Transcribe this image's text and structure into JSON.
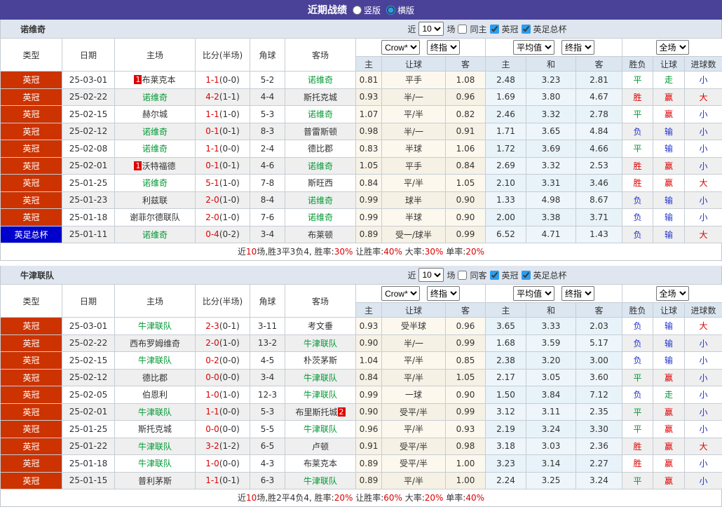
{
  "colors": {
    "titlebar_purple": "#4a4298",
    "league_badge_red": "#cc3300",
    "cup_badge_blue": "#0000cc",
    "win_red": "#dd0000",
    "draw_green": "#009933",
    "lose_blue": "#2233cc",
    "header_blue": "#dce6f0",
    "odds_cream": "#fdf8ee",
    "odds_lightblue": "#e7f2f9"
  },
  "titlebar": {
    "title": "近期战绩",
    "radios": [
      {
        "label": "竖版",
        "checked": false
      },
      {
        "label": "横版",
        "checked": true
      }
    ]
  },
  "table_header": {
    "type": "类型",
    "date": "日期",
    "home": "主场",
    "score": "比分(半场)",
    "corner": "角球",
    "away": "客场",
    "group1_select1": "Crow*",
    "group1_select2": "终指",
    "group2_select1": "平均值",
    "group2_select2": "终指",
    "group3_select": "全场",
    "sub1_home": "主",
    "sub1_line": "让球",
    "sub1_away": "客",
    "sub2_home": "主",
    "sub2_draw": "和",
    "sub2_away": "客",
    "sub3_wl": "胜负",
    "sub3_handicap": "让球",
    "sub3_goals": "进球数"
  },
  "sections": [
    {
      "team": "诺维奇",
      "filter": {
        "near_label": "近",
        "count": "10",
        "games_label": "场",
        "same_label": "同主",
        "same_checked": false,
        "leagues": [
          {
            "label": "英冠",
            "checked": true
          },
          {
            "label": "英足总杯",
            "checked": true
          }
        ]
      },
      "rows": [
        {
          "type": "英冠",
          "type_c": "t-red",
          "date": "25-03-01",
          "home_badge": "1",
          "home": "布莱克本",
          "home_c": "",
          "ft": "1-1",
          "ht": "(0-0)",
          "corner": "5-2",
          "away": "诺维奇",
          "away_badge": "",
          "away_c": "green",
          "o1h": "0.81",
          "o1l": "平手",
          "o1a": "1.08",
          "o2h": "2.48",
          "o2d": "3.23",
          "o2a": "2.81",
          "rw": "平",
          "rw_c": "green",
          "rh": "走",
          "rh_c": "green",
          "rg": "小",
          "rg_c": "blue"
        },
        {
          "type": "英冠",
          "type_c": "t-red",
          "date": "25-02-22",
          "home_badge": "",
          "home": "诺维奇",
          "home_c": "green",
          "ft": "4-2",
          "ht": "(1-1)",
          "corner": "4-4",
          "away": "斯托克城",
          "away_badge": "",
          "away_c": "",
          "o1h": "0.93",
          "o1l": "半/一",
          "o1a": "0.96",
          "o2h": "1.69",
          "o2d": "3.80",
          "o2a": "4.67",
          "rw": "胜",
          "rw_c": "red",
          "rh": "赢",
          "rh_c": "red",
          "rg": "大",
          "rg_c": "red"
        },
        {
          "type": "英冠",
          "type_c": "t-red",
          "date": "25-02-15",
          "home_badge": "",
          "home": "赫尔城",
          "home_c": "",
          "ft": "1-1",
          "ht": "(1-0)",
          "corner": "5-3",
          "away": "诺维奇",
          "away_badge": "",
          "away_c": "green",
          "o1h": "1.07",
          "o1l": "平/半",
          "o1a": "0.82",
          "o2h": "2.46",
          "o2d": "3.32",
          "o2a": "2.78",
          "rw": "平",
          "rw_c": "green",
          "rh": "赢",
          "rh_c": "red",
          "rg": "小",
          "rg_c": "blue"
        },
        {
          "type": "英冠",
          "type_c": "t-red",
          "date": "25-02-12",
          "home_badge": "",
          "home": "诺维奇",
          "home_c": "green",
          "ft": "0-1",
          "ht": "(0-1)",
          "corner": "8-3",
          "away": "普雷斯顿",
          "away_badge": "",
          "away_c": "",
          "o1h": "0.98",
          "o1l": "半/一",
          "o1a": "0.91",
          "o2h": "1.71",
          "o2d": "3.65",
          "o2a": "4.84",
          "rw": "负",
          "rw_c": "blue",
          "rh": "输",
          "rh_c": "blue",
          "rg": "小",
          "rg_c": "blue"
        },
        {
          "type": "英冠",
          "type_c": "t-red",
          "date": "25-02-08",
          "home_badge": "",
          "home": "诺维奇",
          "home_c": "green",
          "ft": "1-1",
          "ht": "(0-0)",
          "corner": "2-4",
          "away": "德比郡",
          "away_badge": "",
          "away_c": "",
          "o1h": "0.83",
          "o1l": "半球",
          "o1a": "1.06",
          "o2h": "1.72",
          "o2d": "3.69",
          "o2a": "4.66",
          "rw": "平",
          "rw_c": "green",
          "rh": "输",
          "rh_c": "blue",
          "rg": "小",
          "rg_c": "blue"
        },
        {
          "type": "英冠",
          "type_c": "t-red",
          "date": "25-02-01",
          "home_badge": "1",
          "home": "沃特福德",
          "home_c": "",
          "ft": "0-1",
          "ht": "(0-1)",
          "corner": "4-6",
          "away": "诺维奇",
          "away_badge": "",
          "away_c": "green",
          "o1h": "1.05",
          "o1l": "平手",
          "o1a": "0.84",
          "o2h": "2.69",
          "o2d": "3.32",
          "o2a": "2.53",
          "rw": "胜",
          "rw_c": "red",
          "rh": "赢",
          "rh_c": "red",
          "rg": "小",
          "rg_c": "blue"
        },
        {
          "type": "英冠",
          "type_c": "t-red",
          "date": "25-01-25",
          "home_badge": "",
          "home": "诺维奇",
          "home_c": "green",
          "ft": "5-1",
          "ht": "(1-0)",
          "corner": "7-8",
          "away": "斯旺西",
          "away_badge": "",
          "away_c": "",
          "o1h": "0.84",
          "o1l": "平/半",
          "o1a": "1.05",
          "o2h": "2.10",
          "o2d": "3.31",
          "o2a": "3.46",
          "rw": "胜",
          "rw_c": "red",
          "rh": "赢",
          "rh_c": "red",
          "rg": "大",
          "rg_c": "red"
        },
        {
          "type": "英冠",
          "type_c": "t-red",
          "date": "25-01-23",
          "home_badge": "",
          "home": "利兹联",
          "home_c": "",
          "ft": "2-0",
          "ht": "(1-0)",
          "corner": "8-4",
          "away": "诺维奇",
          "away_badge": "",
          "away_c": "green",
          "o1h": "0.99",
          "o1l": "球半",
          "o1a": "0.90",
          "o2h": "1.33",
          "o2d": "4.98",
          "o2a": "8.67",
          "rw": "负",
          "rw_c": "blue",
          "rh": "输",
          "rh_c": "blue",
          "rg": "小",
          "rg_c": "blue"
        },
        {
          "type": "英冠",
          "type_c": "t-red",
          "date": "25-01-18",
          "home_badge": "",
          "home": "谢菲尔德联队",
          "home_c": "",
          "ft": "2-0",
          "ht": "(1-0)",
          "corner": "7-6",
          "away": "诺维奇",
          "away_badge": "",
          "away_c": "green",
          "o1h": "0.99",
          "o1l": "半球",
          "o1a": "0.90",
          "o2h": "2.00",
          "o2d": "3.38",
          "o2a": "3.71",
          "rw": "负",
          "rw_c": "blue",
          "rh": "输",
          "rh_c": "blue",
          "rg": "小",
          "rg_c": "blue"
        },
        {
          "type": "英足总杯",
          "type_c": "t-blue",
          "date": "25-01-11",
          "home_badge": "",
          "home": "诺维奇",
          "home_c": "green",
          "ft": "0-4",
          "ht": "(0-2)",
          "corner": "3-4",
          "away": "布莱顿",
          "away_badge": "",
          "away_c": "",
          "o1h": "0.89",
          "o1l": "受一/球半",
          "o1a": "0.99",
          "o2h": "6.52",
          "o2d": "4.71",
          "o2a": "1.43",
          "rw": "负",
          "rw_c": "blue",
          "rh": "输",
          "rh_c": "blue",
          "rg": "大",
          "rg_c": "red"
        }
      ],
      "summary": [
        {
          "t": "近"
        },
        {
          "t": "10",
          "c": "red"
        },
        {
          "t": "场,胜3平3负4, 胜率:"
        },
        {
          "t": "30%",
          "c": "red"
        },
        {
          "t": " 让胜率:"
        },
        {
          "t": "40%",
          "c": "red"
        },
        {
          "t": " 大率:"
        },
        {
          "t": "30%",
          "c": "red"
        },
        {
          "t": " 单率:"
        },
        {
          "t": "20%",
          "c": "red"
        }
      ]
    },
    {
      "team": "牛津联队",
      "filter": {
        "near_label": "近",
        "count": "10",
        "games_label": "场",
        "same_label": "同客",
        "same_checked": false,
        "leagues": [
          {
            "label": "英冠",
            "checked": true
          },
          {
            "label": "英足总杯",
            "checked": true
          }
        ]
      },
      "rows": [
        {
          "type": "英冠",
          "type_c": "t-red",
          "date": "25-03-01",
          "home_badge": "",
          "home": "牛津联队",
          "home_c": "green",
          "ft": "2-3",
          "ht": "(0-1)",
          "corner": "3-11",
          "away": "考文垂",
          "away_badge": "",
          "away_c": "",
          "o1h": "0.93",
          "o1l": "受半球",
          "o1a": "0.96",
          "o2h": "3.65",
          "o2d": "3.33",
          "o2a": "2.03",
          "rw": "负",
          "rw_c": "blue",
          "rh": "输",
          "rh_c": "blue",
          "rg": "大",
          "rg_c": "red"
        },
        {
          "type": "英冠",
          "type_c": "t-red",
          "date": "25-02-22",
          "home_badge": "",
          "home": "西布罗姆维奇",
          "home_c": "",
          "ft": "2-0",
          "ht": "(1-0)",
          "corner": "13-2",
          "away": "牛津联队",
          "away_badge": "",
          "away_c": "green",
          "o1h": "0.90",
          "o1l": "半/一",
          "o1a": "0.99",
          "o2h": "1.68",
          "o2d": "3.59",
          "o2a": "5.17",
          "rw": "负",
          "rw_c": "blue",
          "rh": "输",
          "rh_c": "blue",
          "rg": "小",
          "rg_c": "blue"
        },
        {
          "type": "英冠",
          "type_c": "t-red",
          "date": "25-02-15",
          "home_badge": "",
          "home": "牛津联队",
          "home_c": "green",
          "ft": "0-2",
          "ht": "(0-0)",
          "corner": "4-5",
          "away": "朴茨茅斯",
          "away_badge": "",
          "away_c": "",
          "o1h": "1.04",
          "o1l": "平/半",
          "o1a": "0.85",
          "o2h": "2.38",
          "o2d": "3.20",
          "o2a": "3.00",
          "rw": "负",
          "rw_c": "blue",
          "rh": "输",
          "rh_c": "blue",
          "rg": "小",
          "rg_c": "blue"
        },
        {
          "type": "英冠",
          "type_c": "t-red",
          "date": "25-02-12",
          "home_badge": "",
          "home": "德比郡",
          "home_c": "",
          "ft": "0-0",
          "ht": "(0-0)",
          "corner": "3-4",
          "away": "牛津联队",
          "away_badge": "",
          "away_c": "green",
          "o1h": "0.84",
          "o1l": "平/半",
          "o1a": "1.05",
          "o2h": "2.17",
          "o2d": "3.05",
          "o2a": "3.60",
          "rw": "平",
          "rw_c": "green",
          "rh": "赢",
          "rh_c": "red",
          "rg": "小",
          "rg_c": "blue"
        },
        {
          "type": "英冠",
          "type_c": "t-red",
          "date": "25-02-05",
          "home_badge": "",
          "home": "伯恩利",
          "home_c": "",
          "ft": "1-0",
          "ht": "(1-0)",
          "corner": "12-3",
          "away": "牛津联队",
          "away_badge": "",
          "away_c": "green",
          "o1h": "0.99",
          "o1l": "一球",
          "o1a": "0.90",
          "o2h": "1.50",
          "o2d": "3.84",
          "o2a": "7.12",
          "rw": "负",
          "rw_c": "blue",
          "rh": "走",
          "rh_c": "green",
          "rg": "小",
          "rg_c": "blue"
        },
        {
          "type": "英冠",
          "type_c": "t-red",
          "date": "25-02-01",
          "home_badge": "",
          "home": "牛津联队",
          "home_c": "green",
          "ft": "1-1",
          "ht": "(0-0)",
          "corner": "5-3",
          "away": "布里斯托城",
          "away_badge": "2",
          "away_c": "",
          "o1h": "0.90",
          "o1l": "受平/半",
          "o1a": "0.99",
          "o2h": "3.12",
          "o2d": "3.11",
          "o2a": "2.35",
          "rw": "平",
          "rw_c": "green",
          "rh": "赢",
          "rh_c": "red",
          "rg": "小",
          "rg_c": "blue"
        },
        {
          "type": "英冠",
          "type_c": "t-red",
          "date": "25-01-25",
          "home_badge": "",
          "home": "斯托克城",
          "home_c": "",
          "ft": "0-0",
          "ht": "(0-0)",
          "corner": "5-5",
          "away": "牛津联队",
          "away_badge": "",
          "away_c": "green",
          "o1h": "0.96",
          "o1l": "平/半",
          "o1a": "0.93",
          "o2h": "2.19",
          "o2d": "3.24",
          "o2a": "3.30",
          "rw": "平",
          "rw_c": "green",
          "rh": "赢",
          "rh_c": "red",
          "rg": "小",
          "rg_c": "blue"
        },
        {
          "type": "英冠",
          "type_c": "t-red",
          "date": "25-01-22",
          "home_badge": "",
          "home": "牛津联队",
          "home_c": "green",
          "ft": "3-2",
          "ht": "(1-2)",
          "corner": "6-5",
          "away": "卢顿",
          "away_badge": "",
          "away_c": "",
          "o1h": "0.91",
          "o1l": "受平/半",
          "o1a": "0.98",
          "o2h": "3.18",
          "o2d": "3.03",
          "o2a": "2.36",
          "rw": "胜",
          "rw_c": "red",
          "rh": "赢",
          "rh_c": "red",
          "rg": "大",
          "rg_c": "red"
        },
        {
          "type": "英冠",
          "type_c": "t-red",
          "date": "25-01-18",
          "home_badge": "",
          "home": "牛津联队",
          "home_c": "green",
          "ft": "1-0",
          "ht": "(0-0)",
          "corner": "4-3",
          "away": "布莱克本",
          "away_badge": "",
          "away_c": "",
          "o1h": "0.89",
          "o1l": "受平/半",
          "o1a": "1.00",
          "o2h": "3.23",
          "o2d": "3.14",
          "o2a": "2.27",
          "rw": "胜",
          "rw_c": "red",
          "rh": "赢",
          "rh_c": "red",
          "rg": "小",
          "rg_c": "blue"
        },
        {
          "type": "英冠",
          "type_c": "t-red",
          "date": "25-01-15",
          "home_badge": "",
          "home": "普利茅斯",
          "home_c": "",
          "ft": "1-1",
          "ht": "(0-1)",
          "corner": "6-3",
          "away": "牛津联队",
          "away_badge": "",
          "away_c": "green",
          "o1h": "0.89",
          "o1l": "平/半",
          "o1a": "1.00",
          "o2h": "2.24",
          "o2d": "3.25",
          "o2a": "3.24",
          "rw": "平",
          "rw_c": "green",
          "rh": "赢",
          "rh_c": "red",
          "rg": "小",
          "rg_c": "blue"
        }
      ],
      "summary": [
        {
          "t": "近"
        },
        {
          "t": "10",
          "c": "red"
        },
        {
          "t": "场,胜2平4负4, 胜率:"
        },
        {
          "t": "20%",
          "c": "red"
        },
        {
          "t": " 让胜率:"
        },
        {
          "t": "60%",
          "c": "red"
        },
        {
          "t": " 大率:"
        },
        {
          "t": "20%",
          "c": "red"
        },
        {
          "t": " 单率:"
        },
        {
          "t": "40%",
          "c": "red"
        }
      ]
    }
  ]
}
